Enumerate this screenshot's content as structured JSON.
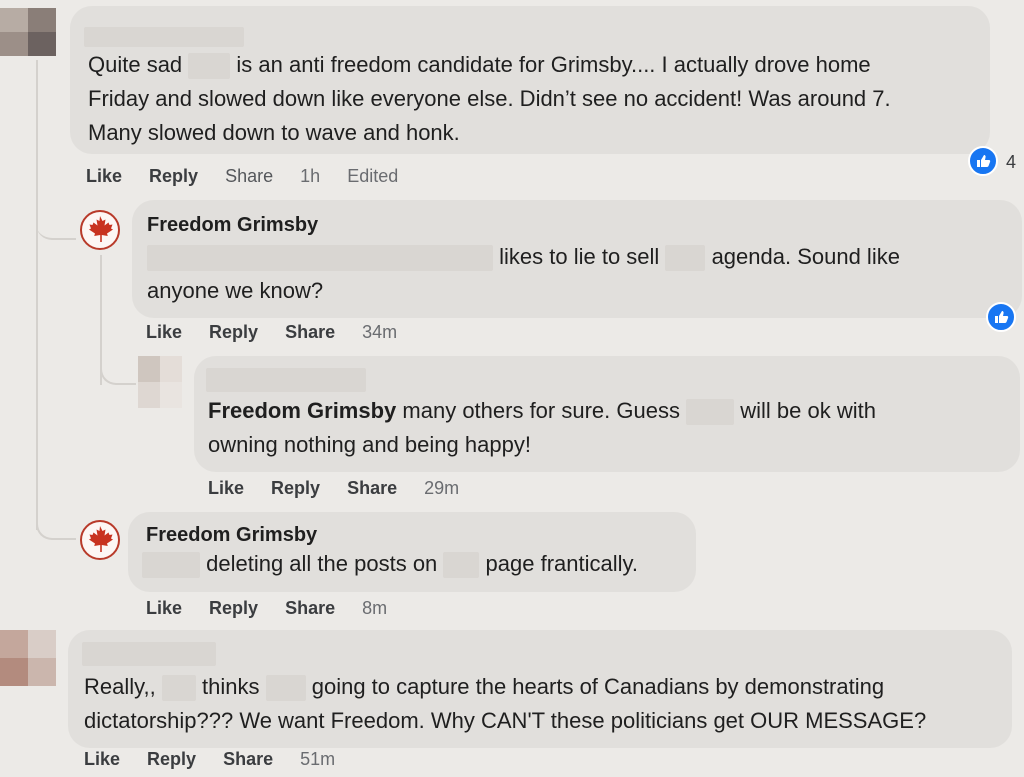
{
  "comment1": {
    "text": "Quite sad ███ is an anti freedom candidate for Grimsby.... I actually drove home Friday and slowed down like everyone else. Didn't see no accident! Was around 7. Many slowed down to wave and honk.",
    "line1a": "Quite sad",
    "line1b": "is an anti freedom candidate for Grimsby.... I actually drove home",
    "line2": "Friday and slowed down like everyone else. Didn’t see no accident! Was around 7.",
    "line3": "Many slowed down to wave and honk.",
    "like": "Like",
    "reply": "Reply",
    "share": "Share",
    "time": "1h",
    "edited": "Edited",
    "reaction_count": "4"
  },
  "reply1": {
    "author": "Freedom Grimsby",
    "line1a": "likes to lie to sell",
    "line1b": "agenda. Sound like",
    "line2": "anyone we know?",
    "like": "Like",
    "reply": "Reply",
    "share": "Share",
    "time": "34m"
  },
  "reply2": {
    "author": "Freedom Grimsby",
    "line1a": "many others for sure. Guess",
    "line1b": "will be ok with",
    "line2": "owning nothing and being happy!",
    "like": "Like",
    "reply": "Reply",
    "share": "Share",
    "time": "29m"
  },
  "reply3": {
    "author": "Freedom Grimsby",
    "line1a": "deleting all the posts on",
    "line1b": "page frantically.",
    "like": "Like",
    "reply": "Reply",
    "share": "Share",
    "time": "8m"
  },
  "comment2": {
    "line1a": "Really,,",
    "line1b": "thinks",
    "line1c": "going to capture the hearts of Canadians by demonstrating",
    "line2": "dictatorship??? We want Freedom. Why CAN'T these politicians get OUR MESSAGE?",
    "like": "Like",
    "reply": "Reply",
    "share": "Share",
    "time": "51m"
  },
  "colors": {
    "like_blue": "#1876f2",
    "bubble": "#e1dfdc",
    "background": "#eceae7",
    "maple_red": "#c8321f"
  },
  "icons": [
    "thumbs-up-icon",
    "maple-leaf-icon"
  ]
}
